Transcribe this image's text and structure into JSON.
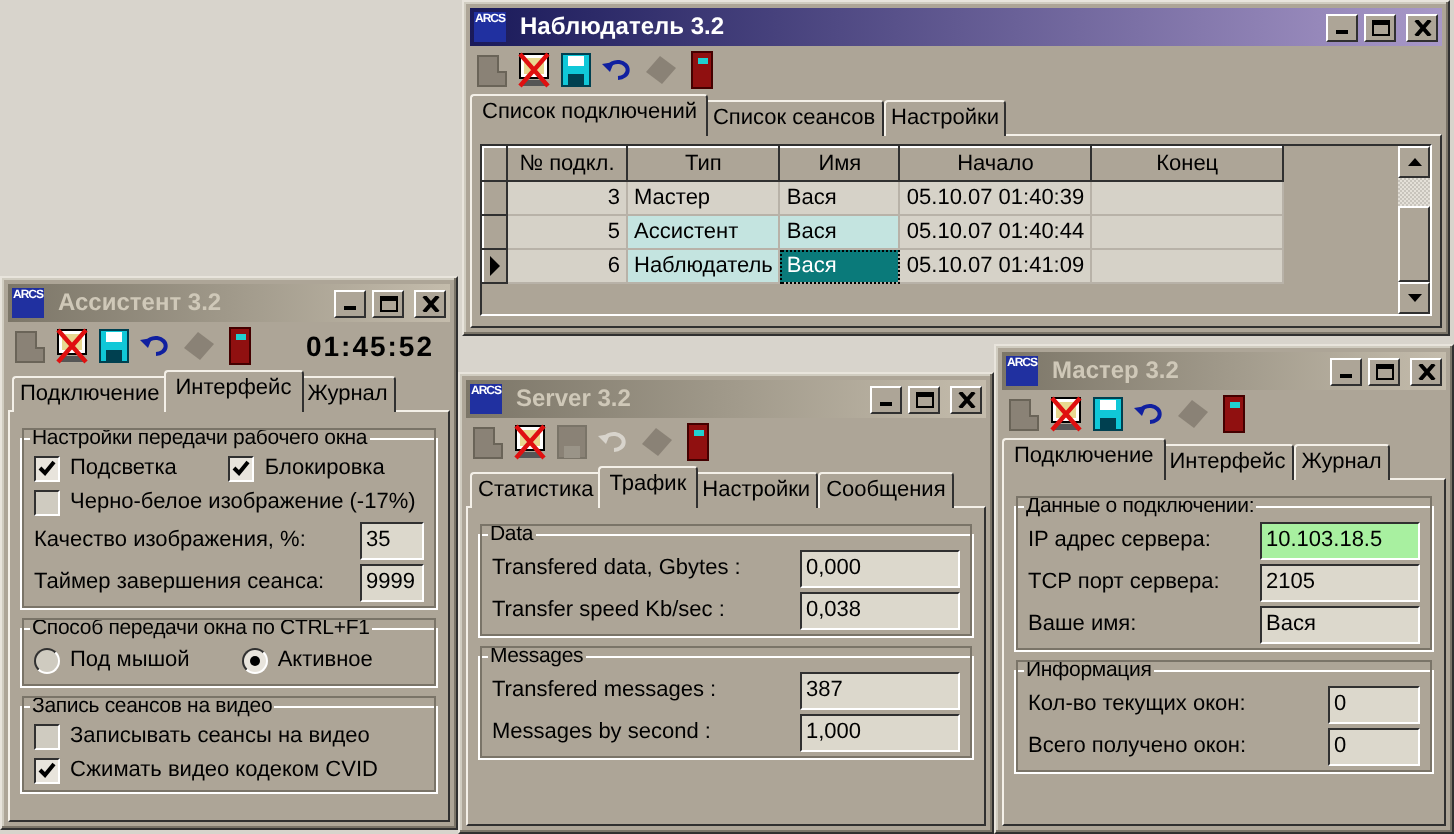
{
  "windows": [
    {
      "logo": "ARCS",
      "title": "Наблюдатель 3.2",
      "active": true,
      "toolbar": [
        {
          "kind": "page",
          "disabled": true
        },
        {
          "kind": "monitor",
          "disabled": false
        },
        {
          "kind": "disk",
          "disabled": false
        },
        {
          "kind": "undo",
          "disabled": false
        },
        {
          "kind": "gem",
          "disabled": true
        },
        {
          "kind": "door",
          "disabled": false
        }
      ],
      "tabs": [
        {
          "label": "Список подключений",
          "selected": true
        },
        {
          "label": "Список сеансов",
          "selected": false
        },
        {
          "label": "Настройки",
          "selected": false
        }
      ],
      "content": {
        "kind": "grid",
        "columns": [
          "№ подкл.",
          "Тип",
          "Имя",
          "Начало",
          "Конец"
        ],
        "rows": [
          {
            "current": false,
            "cells": [
              {
                "text": "3",
                "selected": false,
                "focused": false
              },
              {
                "text": "Мастер",
                "selected": false,
                "focused": false
              },
              {
                "text": "Вася",
                "selected": false,
                "focused": false
              },
              {
                "text": "05.10.07 01:40:39",
                "selected": false,
                "focused": false
              },
              {
                "text": "",
                "selected": false,
                "focused": false
              }
            ]
          },
          {
            "current": false,
            "cells": [
              {
                "text": "5",
                "selected": false,
                "focused": false
              },
              {
                "text": "Ассистент",
                "selected": true,
                "focused": false
              },
              {
                "text": "Вася",
                "selected": true,
                "focused": false
              },
              {
                "text": "05.10.07 01:40:44",
                "selected": false,
                "focused": false
              },
              {
                "text": "",
                "selected": false,
                "focused": false
              }
            ]
          },
          {
            "current": true,
            "cells": [
              {
                "text": "6",
                "selected": false,
                "focused": false
              },
              {
                "text": "Наблюдатель",
                "selected": true,
                "focused": false
              },
              {
                "text": "Вася",
                "selected": true,
                "focused": true
              },
              {
                "text": "05.10.07 01:41:09",
                "selected": false,
                "focused": false
              },
              {
                "text": "",
                "selected": false,
                "focused": false
              }
            ]
          }
        ]
      }
    },
    {
      "logo": "ARCS",
      "title": "Ассистент 3.2",
      "active": false,
      "clock": "01:45:52",
      "toolbar": [
        {
          "kind": "page",
          "disabled": true
        },
        {
          "kind": "monitor",
          "disabled": false
        },
        {
          "kind": "disk",
          "disabled": false
        },
        {
          "kind": "undo",
          "disabled": false
        },
        {
          "kind": "gem",
          "disabled": true
        },
        {
          "kind": "door",
          "disabled": false
        }
      ],
      "tabs": [
        {
          "label": "Подключение",
          "selected": false
        },
        {
          "label": "Интерфейс",
          "selected": true
        },
        {
          "label": "Журнал",
          "selected": false
        }
      ],
      "content": {
        "kind": "form",
        "groups": [
          {
            "title": "Настройки передачи рабочего окна",
            "items": [
              {
                "kind": "checks",
                "checks": [
                  {
                    "label": "Подсветка",
                    "checked": true
                  },
                  {
                    "label": "Блокировка",
                    "checked": true
                  }
                ]
              },
              {
                "kind": "checks",
                "checks": [
                  {
                    "label": "Черно-белое изображение (-17%)",
                    "checked": false
                  }
                ]
              },
              {
                "kind": "field",
                "label": "Качество изображения, %:",
                "value": "35"
              },
              {
                "kind": "field",
                "label": "Таймер завершения сеанса:",
                "value": "9999"
              }
            ]
          },
          {
            "title": "Способ передачи окна по CTRL+F1",
            "items": [
              {
                "kind": "radios",
                "options": [
                  {
                    "label": "Под мышой",
                    "selected": false
                  },
                  {
                    "label": "Активное",
                    "selected": true
                  }
                ]
              }
            ]
          },
          {
            "title": "Запись сеансов на видео",
            "items": [
              {
                "kind": "checks",
                "checks": [
                  {
                    "label": "Записывать сеансы на видео",
                    "checked": false
                  }
                ]
              },
              {
                "kind": "checks",
                "checks": [
                  {
                    "label": "Сжимать видео кодеком CVID",
                    "checked": true
                  }
                ]
              }
            ]
          }
        ]
      }
    },
    {
      "logo": "ARCS",
      "title": "Server 3.2",
      "active": false,
      "toolbar": [
        {
          "kind": "page",
          "disabled": true
        },
        {
          "kind": "monitor",
          "disabled": false
        },
        {
          "kind": "disk",
          "disabled": true
        },
        {
          "kind": "undo",
          "disabled": true
        },
        {
          "kind": "gem",
          "disabled": true
        },
        {
          "kind": "door",
          "disabled": false
        }
      ],
      "tabs": [
        {
          "label": "Статистика",
          "selected": false
        },
        {
          "label": "Трафик",
          "selected": true
        },
        {
          "label": "Настройки",
          "selected": false
        },
        {
          "label": "Сообщения",
          "selected": false
        }
      ],
      "content": {
        "kind": "form",
        "groups": [
          {
            "title": "Data",
            "items": [
              {
                "kind": "field",
                "label": "Transfered data, Gbytes :",
                "value": "0,000"
              },
              {
                "kind": "field",
                "label": "Transfer speed  Kb/sec :",
                "value": "0,038"
              }
            ]
          },
          {
            "title": "Messages",
            "items": [
              {
                "kind": "field",
                "label": "Transfered messages :",
                "value": "387"
              },
              {
                "kind": "field",
                "label": "Messages by second :",
                "value": "1,000"
              }
            ]
          }
        ]
      }
    },
    {
      "logo": "ARCS",
      "title": "Мастер 3.2",
      "active": false,
      "toolbar": [
        {
          "kind": "page",
          "disabled": true
        },
        {
          "kind": "monitor",
          "disabled": false
        },
        {
          "kind": "disk",
          "disabled": false
        },
        {
          "kind": "undo",
          "disabled": false
        },
        {
          "kind": "gem",
          "disabled": true
        },
        {
          "kind": "door",
          "disabled": false
        }
      ],
      "tabs": [
        {
          "label": "Подключение",
          "selected": true
        },
        {
          "label": "Интерфейс",
          "selected": false
        },
        {
          "label": "Журнал",
          "selected": false
        }
      ],
      "content": {
        "kind": "form",
        "groups": [
          {
            "title": "Данные о подключении:",
            "items": [
              {
                "kind": "field",
                "label": "IP адрес сервера:",
                "value": "10.103.18.5",
                "highlighted": true
              },
              {
                "kind": "field",
                "label": "TCP порт сервера:",
                "value": "2105",
                "highlighted": false
              },
              {
                "kind": "field",
                "label": "Ваше имя:",
                "value": "Вася",
                "highlighted": false
              }
            ]
          },
          {
            "title": "Информация",
            "items": [
              {
                "kind": "field",
                "label": "Кол-во текущих окон:",
                "value": "0",
                "highlighted": false
              },
              {
                "kind": "field",
                "label": "Всего получено окон:",
                "value": "0",
                "highlighted": false
              }
            ]
          }
        ]
      }
    }
  ]
}
